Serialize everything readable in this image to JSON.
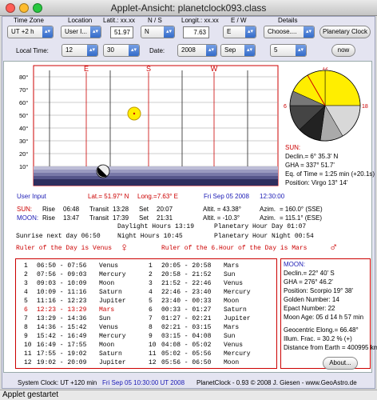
{
  "window": {
    "title": "Applet-Ansicht: planetclock093.class"
  },
  "status_bar": {
    "text": "Applet gestartet"
  },
  "controls": {
    "headers": {
      "tz": "Time Zone",
      "loc": "Location",
      "lat": "Latit.: xx.xx",
      "ns": "N / S",
      "lon": "Longit.: xx.xx",
      "ew": "E / W",
      "details": "Details"
    },
    "tz_value": "UT +2 h",
    "loc_value": "User I...",
    "lat_value": "51.97",
    "ns_value": "N",
    "lon_value": "7.63",
    "ew_value": "E",
    "details_value": "Choose....",
    "planetary_clock_btn": "Planetary Clock",
    "local_time_label": "Local Time:",
    "hour_value": "12",
    "min_value": "30",
    "date_label": "Date:",
    "year_value": "2008",
    "month_value": "Sep",
    "day_value": "5",
    "now_btn": "now"
  },
  "chart": {
    "dir_labels": [
      "E",
      "S",
      "W"
    ],
    "y_ticks": [
      "80°",
      "70°",
      "60°",
      "50°",
      "40°",
      "30°",
      "20°",
      "10°"
    ]
  },
  "clock": {
    "hours": [
      "12",
      "18",
      "6"
    ],
    "sun_header": "SUN:",
    "sun_lines": [
      "Declin.= 6° 35.3' N",
      "GHA = 337° 51.7'",
      "Eq. of Time = 1:25 min (+20.1s)",
      "Position: Virgo 13° 14'"
    ]
  },
  "user_line": {
    "label": "User Input",
    "lat": "Lat.= 51.97° N",
    "lon": "Long.=7.63° E",
    "date": "Fri Sep 05 2008",
    "time": "12:30:00"
  },
  "sun_row": {
    "label": "SUN:",
    "rise_l": "Rise",
    "rise": "06:48",
    "transit_l": "Transit",
    "transit": "13:28",
    "set_l": "Set",
    "set": "20:07",
    "alt": "Altit. = 43.38°",
    "azi_l": "Azim.",
    "azi": "= 160.0°  (SSE)"
  },
  "moon_row": {
    "label": "MOON:",
    "rise_l": "Rise",
    "rise": "13:47",
    "transit_l": "Transit",
    "transit": "17:39",
    "set_l": "Set",
    "set": "21:31",
    "alt": "Altit. = -10.3°",
    "azi_l": "Azim.",
    "azi": "= 115.1°  (ESE)"
  },
  "hours_info": {
    "daylight": "Daylight Hours  13:19",
    "planetary_day": "Planetary Hour Day     01:07",
    "sunrise_next": "Sunrise next day 06:50",
    "night": "Night Hours  10:45",
    "planetary_night": "Planetary Hour Night 00:54"
  },
  "ruler": {
    "day": "Ruler of the Day is Venus",
    "hour": "Ruler of the 6.Hour of the Day is Mars",
    "venus_symbol": "♀",
    "mars_symbol": "♂"
  },
  "hours_table_left": [
    {
      "n": "1",
      "t": "06:50 - 07:56",
      "p": "Venus"
    },
    {
      "n": "2",
      "t": "07:56 - 09:03",
      "p": "Mercury"
    },
    {
      "n": "3",
      "t": "09:03 - 10:09",
      "p": "Moon"
    },
    {
      "n": "4",
      "t": "10:09 - 11:16",
      "p": "Saturn"
    },
    {
      "n": "5",
      "t": "11:16 - 12:23",
      "p": "Jupiter"
    },
    {
      "n": "6",
      "t": "12:23 - 13:29",
      "p": "Mars"
    },
    {
      "n": "7",
      "t": "13:29 - 14:36",
      "p": "Sun"
    },
    {
      "n": "8",
      "t": "14:36 - 15:42",
      "p": "Venus"
    },
    {
      "n": "9",
      "t": "15:42 - 16:49",
      "p": "Mercury"
    },
    {
      "n": "10",
      "t": "16:49 - 17:55",
      "p": "Moon"
    },
    {
      "n": "11",
      "t": "17:55 - 19:02",
      "p": "Saturn"
    },
    {
      "n": "12",
      "t": "19:02 - 20:09",
      "p": "Jupiter"
    }
  ],
  "hours_table_right": [
    {
      "n": "1",
      "t": "20:05 - 20:58",
      "p": "Mars"
    },
    {
      "n": "2",
      "t": "20:58 - 21:52",
      "p": "Sun"
    },
    {
      "n": "3",
      "t": "21:52 - 22:46",
      "p": "Venus"
    },
    {
      "n": "4",
      "t": "22:46 - 23:40",
      "p": "Mercury"
    },
    {
      "n": "5",
      "t": "23:40 - 00:33",
      "p": "Moon"
    },
    {
      "n": "6",
      "t": "00:33 - 01:27",
      "p": "Saturn"
    },
    {
      "n": "7",
      "t": "01:27 - 02:21",
      "p": "Jupiter"
    },
    {
      "n": "8",
      "t": "02:21 - 03:15",
      "p": "Mars"
    },
    {
      "n": "9",
      "t": "03:15 - 04:08",
      "p": "Sun"
    },
    {
      "n": "10",
      "t": "04:08 - 05:02",
      "p": "Venus"
    },
    {
      "n": "11",
      "t": "05:02 - 05:56",
      "p": "Mercury"
    },
    {
      "n": "12",
      "t": "05:56 - 06:50",
      "p": "Moon"
    }
  ],
  "moon_info": {
    "header": "MOON:",
    "lines": [
      "Declin.= 22° 40' S",
      "GHA = 276° 46.2'",
      "Position: Scorpio 19° 38'",
      "Golden Number: 14",
      "Epact Number: 22",
      "Moon Age: 05 d 14 h 57 min",
      "Geocentric Elong.= 66.48°",
      "Illum. Frac. = 30.2 % (+)",
      "Distance from Earth = 400995 km"
    ]
  },
  "about_btn": "About...",
  "footer": {
    "system_clock": "System Clock: UT +120 min",
    "utc": "Fri Sep 05 10:30:00 UT 2008",
    "copyright": "PlanetClock - 0.93  © 2008 J. Giesen - www.GeoAstro.de"
  }
}
